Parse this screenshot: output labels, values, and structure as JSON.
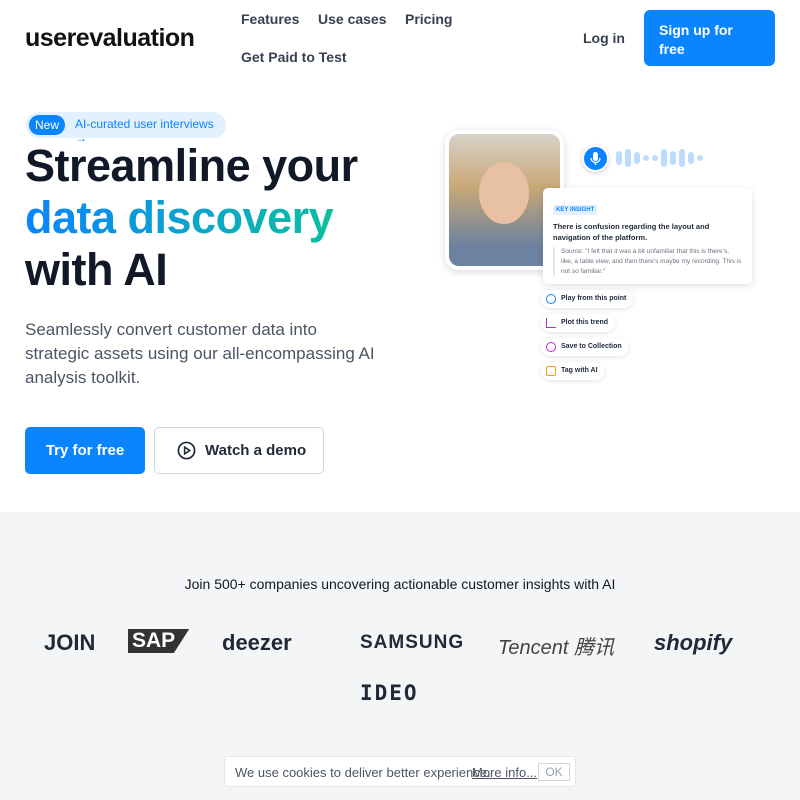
{
  "header": {
    "logo": "userevaluation",
    "nav": [
      "Features",
      "Use cases",
      "Pricing",
      "Get Paid to Test"
    ],
    "login": "Log in",
    "signup": "Sign up for free",
    "signup_arrow": "→"
  },
  "hero": {
    "badge_new": "New",
    "badge_text": "AI-curated user interviews →",
    "title_line1": "Streamline your",
    "title_highlight": "data discovery",
    "title_line3": "with AI",
    "subtitle": "Seamlessly convert customer data into strategic assets using our all-encompassing AI analysis toolkit.",
    "try_label": "Try for free",
    "demo_label": "Watch a demo"
  },
  "illustration": {
    "insight_tag": "KEY INSIGHT",
    "insight_text": "There is confusion regarding the layout and navigation of the platform.",
    "insight_quote": "Source: \"I felt that it was a bit unfamiliar that this is there's, like, a table view, and then there's maybe my recording. This is not so familiar.\"",
    "actions": [
      "Play from this point",
      "Plot this trend",
      "Save to Collection",
      "Tag with AI"
    ],
    "action_colors": [
      "#0a84ff",
      "#c026d3",
      "#c026d3",
      "#f59e0b"
    ]
  },
  "logos": {
    "heading": "Join 500+ companies uncovering actionable customer insights with AI",
    "items": [
      "JOIN",
      "SAP",
      "deezer",
      "SAMSUNG",
      "Tencent 腾讯",
      "shopify",
      "IDEO"
    ]
  },
  "cookie": {
    "text": "We use cookies to deliver better experience.",
    "more": "More info...",
    "ok": "OK"
  }
}
